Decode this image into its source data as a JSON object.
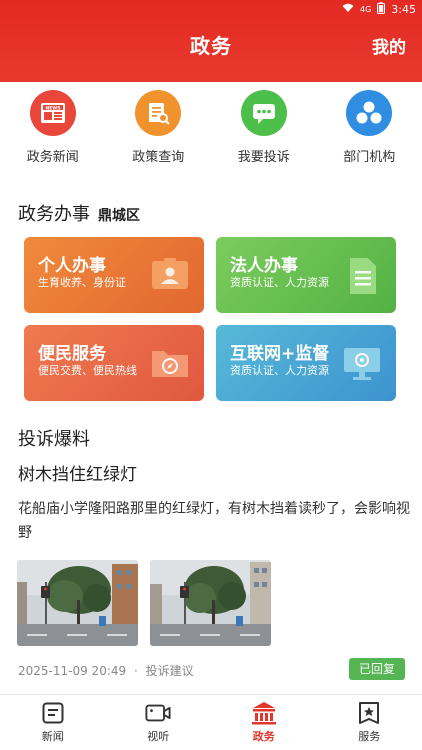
{
  "status": {
    "time": "3:45",
    "signal": "4G"
  },
  "header": {
    "title": "政务",
    "mine_label": "我的"
  },
  "quicknav": [
    {
      "label": "政务新闻",
      "icon": "news-icon",
      "color": "#e8473a"
    },
    {
      "label": "政策查询",
      "icon": "policy-search-icon",
      "color": "#f1932c"
    },
    {
      "label": "我要投诉",
      "icon": "complaint-chat-icon",
      "color": "#4cbf4a"
    },
    {
      "label": "部门机构",
      "icon": "department-icon",
      "color": "#2f8ee1"
    }
  ],
  "services": {
    "title": "政务办事",
    "district": "鼎城区",
    "cards": [
      {
        "title": "个人办事",
        "desc": "生育收养、身份证",
        "icon": "id-card-icon",
        "color": "#e8733a"
      },
      {
        "title": "法人办事",
        "desc": "资质认证、人力资源",
        "icon": "document-icon",
        "color": "#62bb4d"
      },
      {
        "title": "便民服务",
        "desc": "便民交费、便民热线",
        "icon": "folder-compass-icon",
        "color": "#e96845"
      },
      {
        "title": "互联网+监督",
        "desc": "资质认证、人力资源",
        "icon": "monitor-icon",
        "color": "#45a4d3"
      }
    ]
  },
  "complaints": {
    "title": "投诉爆料",
    "item": {
      "title": "树木挡住红绿灯",
      "body": "花船庙小学隆阳路那里的红绿灯，有树木挡着读秒了，会影响视野",
      "datetime": "2025-11-09 20:49",
      "separator": "·",
      "category": "投诉建议",
      "status": "已回复"
    }
  },
  "bottomnav": [
    {
      "label": "新闻",
      "icon": "news-tab-icon",
      "active": false
    },
    {
      "label": "视听",
      "icon": "video-tab-icon",
      "active": false
    },
    {
      "label": "政务",
      "icon": "government-tab-icon",
      "active": true
    },
    {
      "label": "服务",
      "icon": "service-tab-icon",
      "active": false
    }
  ],
  "colors": {
    "brand": "#e32a22",
    "badge": "#56b553",
    "active_tab": "#e2352b"
  }
}
